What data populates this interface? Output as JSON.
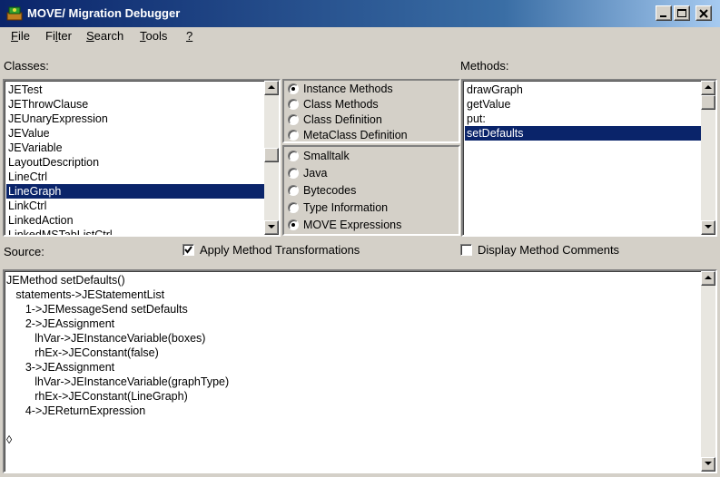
{
  "window": {
    "title": "MOVE/ Migration Debugger"
  },
  "menu": [
    {
      "label": "File",
      "accel": "F",
      "rest": "ile"
    },
    {
      "label": "Filter",
      "accel": "Fi",
      "rest": "lter",
      "pre": "Fi"
    },
    {
      "label": "Search",
      "accel": "S",
      "rest": "earch"
    },
    {
      "label": "Tools",
      "accel": "T",
      "rest": "ools"
    },
    {
      "label": "?",
      "accel": "?",
      "rest": ""
    }
  ],
  "classes": {
    "label": "Classes:",
    "items": [
      "JETest",
      "JEThrowClause",
      "JEUnaryExpression",
      "JEValue",
      "JEVariable",
      "LayoutDescription",
      "LineCtrl",
      "LineGraph",
      "LinkCtrl",
      "LinkedAction",
      "LinkedMSTabListCtrl"
    ],
    "selected": "LineGraph"
  },
  "method_kind": {
    "options": [
      "Instance Methods",
      "Class Methods",
      "Class Definition",
      "MetaClass Definition"
    ],
    "selected": "Instance Methods"
  },
  "view_kind": {
    "options": [
      "Smalltalk",
      "Java",
      "Bytecodes",
      "Type Information",
      "MOVE Expressions"
    ],
    "selected": "MOVE Expressions"
  },
  "methods": {
    "label": "Methods:",
    "items": [
      "drawGraph",
      "getValue",
      "put:",
      "setDefaults"
    ],
    "selected": "setDefaults"
  },
  "source": {
    "label": "Source:",
    "apply_transformations": {
      "label": "Apply Method Transformations",
      "checked": true
    },
    "display_comments": {
      "label": "Display Method Comments",
      "checked": false
    },
    "lines": [
      "JEMethod setDefaults()",
      "   statements->JEStatementList",
      "      1->JEMessageSend setDefaults",
      "      2->JEAssignment",
      "         lhVar->JEInstanceVariable(boxes)",
      "         rhEx->JEConstant(false)",
      "      3->JEAssignment",
      "         lhVar->JEInstanceVariable(graphType)",
      "         rhEx->JEConstant(LineGraph)",
      "      4->JEReturnExpression",
      "",
      "◊"
    ]
  },
  "icons": {
    "app": "app-icon",
    "minimize": "minimize-icon",
    "maximize": "maximize-icon",
    "close": "close-icon"
  }
}
